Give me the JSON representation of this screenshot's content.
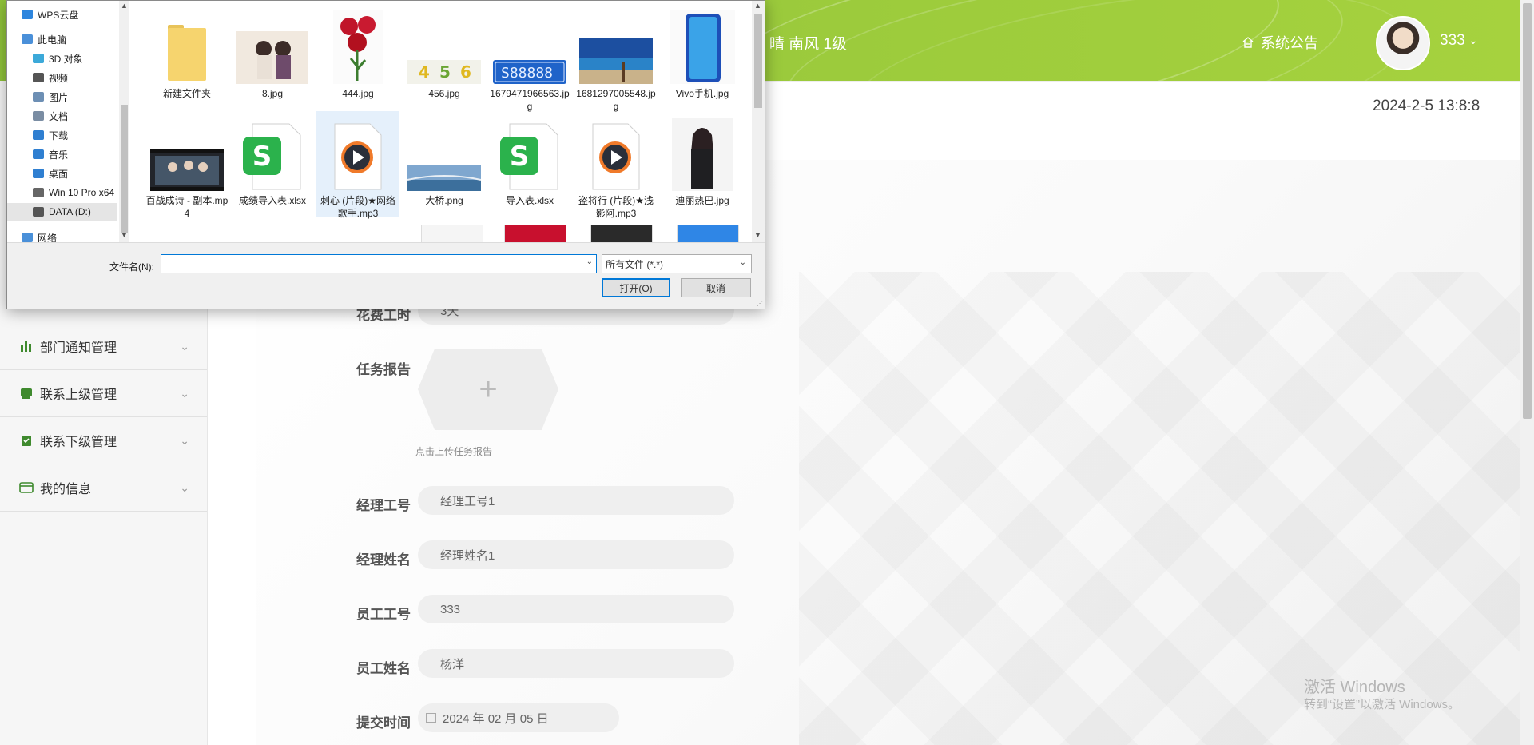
{
  "app": {
    "weather": "° 晴 南风 1级",
    "notice_label": "系统公告",
    "username": "333",
    "datetime": "2024-2-5 13:8:8"
  },
  "sidebar": {
    "items": [
      {
        "label": "部门通知管理",
        "icon": "bar-chart-icon"
      },
      {
        "label": "联系上级管理",
        "icon": "inbox-icon"
      },
      {
        "label": "联系下级管理",
        "icon": "clipboard-check-icon"
      },
      {
        "label": "我的信息",
        "icon": "id-card-icon"
      }
    ]
  },
  "form": {
    "hours_label": "花费工时",
    "hours_value": "3天",
    "report_label": "任务报告",
    "upload_tip": "点击上传任务报告",
    "manager_id_label": "经理工号",
    "manager_id_value": "经理工号1",
    "manager_name_label": "经理姓名",
    "manager_name_value": "经理姓名1",
    "employee_id_label": "员工工号",
    "employee_id_value": "333",
    "employee_name_label": "员工姓名",
    "employee_name_value": "杨洋",
    "submit_time_label": "提交时间",
    "submit_time_value": "2024 年 02 月 05 日"
  },
  "watermark": {
    "line1": "激活 Windows",
    "line2": "转到“设置”以激活 Windows。"
  },
  "dialog": {
    "nav": [
      {
        "label": "WPS云盘",
        "level": 0,
        "color": "#2e86de"
      },
      {
        "label": "此电脑",
        "level": 0,
        "color": "#4a90d9"
      },
      {
        "label": "3D 对象",
        "level": 1,
        "color": "#3ca9d9"
      },
      {
        "label": "视频",
        "level": 1,
        "color": "#555555"
      },
      {
        "label": "图片",
        "level": 1,
        "color": "#6d8fb4"
      },
      {
        "label": "文档",
        "level": 1,
        "color": "#7a8da3"
      },
      {
        "label": "下载",
        "level": 1,
        "color": "#2f7fd1"
      },
      {
        "label": "音乐",
        "level": 1,
        "color": "#2f7fd1"
      },
      {
        "label": "桌面",
        "level": 1,
        "color": "#2f7fd1"
      },
      {
        "label": "Win 10 Pro x64",
        "level": 1,
        "color": "#666666"
      },
      {
        "label": "DATA (D:)",
        "level": 1,
        "color": "#555555",
        "selected": true
      },
      {
        "label": "网络",
        "level": 0,
        "color": "#4a90d9"
      }
    ],
    "files": [
      {
        "name": "新建文件夹",
        "kind": "folder"
      },
      {
        "name": "8.jpg",
        "kind": "photo-people"
      },
      {
        "name": "444.jpg",
        "kind": "photo-roses"
      },
      {
        "name": "456.jpg",
        "kind": "photo-digits"
      },
      {
        "name": "1679471966563.jpg",
        "kind": "photo-plate"
      },
      {
        "name": "1681297005548.jpg",
        "kind": "photo-beach"
      },
      {
        "name": "Vivo手机.jpg",
        "kind": "photo-phone"
      },
      {
        "name": "百战成诗 - 副本.mp4",
        "kind": "video"
      },
      {
        "name": "成绩导入表.xlsx",
        "kind": "xlsx"
      },
      {
        "name": "刺心 (片段)★网络歌手.mp3",
        "kind": "mp3",
        "selected": true
      },
      {
        "name": "大桥.png",
        "kind": "photo-bridge"
      },
      {
        "name": "导入表.xlsx",
        "kind": "xlsx"
      },
      {
        "name": "盗将行 (片段)★浅影阿.mp3",
        "kind": "mp3"
      },
      {
        "name": "迪丽热巴.jpg",
        "kind": "photo-woman"
      }
    ],
    "filename_label": "文件名(N):",
    "filename_value": "",
    "filetype_value": "所有文件 (*.*)",
    "open_label": "打开(O)",
    "cancel_label": "取消"
  }
}
